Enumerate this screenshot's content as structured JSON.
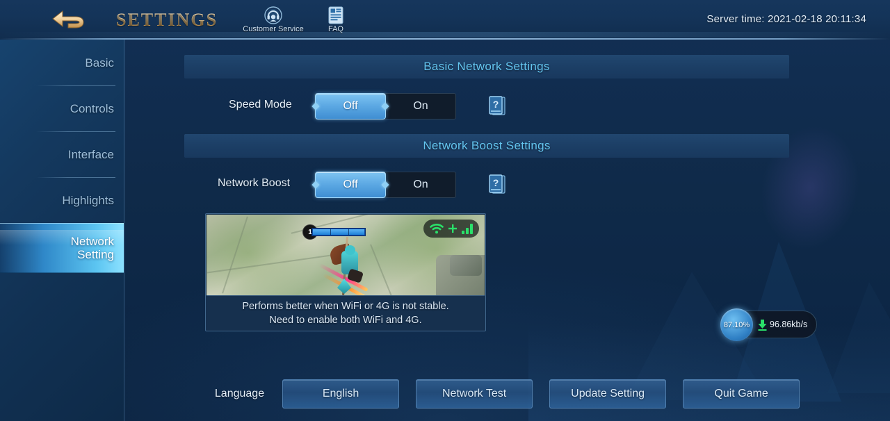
{
  "header": {
    "back_icon": "back-arrow-icon",
    "title": "SETTINGS",
    "customer_service": {
      "icon": "headset-icon",
      "label": "Customer Service"
    },
    "faq": {
      "icon": "document-icon",
      "label": "FAQ"
    },
    "server_time": "Server time: 2021-02-18 20:11:34"
  },
  "sidebar": {
    "items": [
      {
        "label": "Basic",
        "active": false
      },
      {
        "label": "Controls",
        "active": false
      },
      {
        "label": "Interface",
        "active": false
      },
      {
        "label": "Highlights",
        "active": false
      },
      {
        "label": "Network Setting",
        "label_line1": "Network",
        "label_line2": "Setting",
        "active": true
      }
    ]
  },
  "main": {
    "sections": [
      {
        "title": "Basic Network Settings"
      },
      {
        "title": "Network Boost Settings"
      }
    ],
    "rows": [
      {
        "label": "Speed Mode",
        "options": [
          "Off",
          "On"
        ],
        "selected": "Off",
        "help_icon": "help-book-icon"
      },
      {
        "label": "Network Boost",
        "options": [
          "Off",
          "On"
        ],
        "selected": "Off",
        "help_icon": "help-book-icon"
      }
    ],
    "preview": {
      "level_badge": "1",
      "badge_icons": [
        "wifi-icon",
        "plus-icon",
        "signal-bars-icon"
      ],
      "caption_line1": "Performs better when WiFi or 4G is not stable.",
      "caption_line2": "Need to enable both WiFi and 4G."
    },
    "speed_widget": {
      "percent": "87.10%",
      "download_icon": "download-icon",
      "rate": "96.86kb/s"
    },
    "bottom": {
      "language_label": "Language",
      "language_value": "English",
      "network_test": "Network Test",
      "update_setting": "Update Setting",
      "quit_game": "Quit Game"
    }
  },
  "colors": {
    "accent_cyan": "#63c4ef",
    "toggle_selected": "#5eaae4",
    "signal_green": "#2ae06a",
    "title_gold": "#f0ca8e",
    "active_sidebar": "#6fd0f8"
  }
}
